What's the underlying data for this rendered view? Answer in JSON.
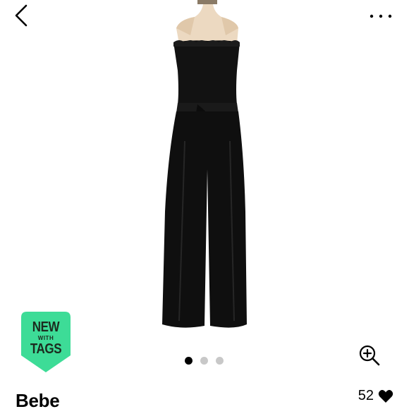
{
  "nav": {
    "back_icon": "chevron-left-icon",
    "more_icon": "more-horizontal-icon"
  },
  "product": {
    "image_description_icon": "product-photo",
    "badge": {
      "line1": "NEW",
      "line2": "WITH",
      "line3": "TAGS",
      "color": "#3ddc97"
    },
    "carousel": {
      "total": 3,
      "active": 1
    },
    "zoom_icon": "zoom-in-icon",
    "brand": "Bebe",
    "likes": "52",
    "like_icon": "heart-icon"
  },
  "colors": {
    "background": "#ffffff",
    "text": "#000000",
    "badge_green": "#3ddc97",
    "dot_inactive": "#c8c8c8"
  }
}
